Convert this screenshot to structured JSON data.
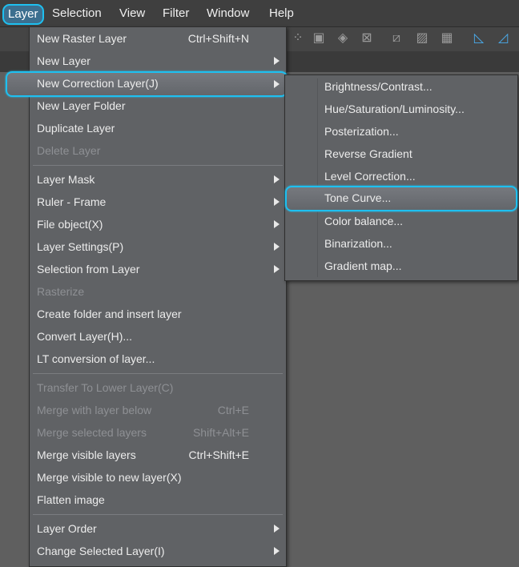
{
  "menubar": {
    "items": [
      "Layer",
      "Selection",
      "View",
      "Filter",
      "Window",
      "Help"
    ]
  },
  "toolbar": {
    "icons": [
      "transform-icon",
      "fill-icon",
      "selection-icon",
      "crop-icon",
      "rule-icon",
      "grid-icon",
      "film-icon",
      "blue-tool-icon-1",
      "blue-tool-icon-2"
    ]
  },
  "layer_menu": {
    "items": [
      {
        "label": "New Raster Layer",
        "shortcut": "Ctrl+Shift+N"
      },
      {
        "label": "New Layer",
        "submenu": true
      },
      {
        "label": "New Correction Layer(J)",
        "submenu": true,
        "highlighted": true
      },
      {
        "label": "New Layer Folder"
      },
      {
        "label": "Duplicate Layer"
      },
      {
        "label": "Delete Layer",
        "disabled": true
      },
      {
        "label": "Layer Mask",
        "submenu": true
      },
      {
        "label": "Ruler - Frame",
        "submenu": true
      },
      {
        "label": "File object(X)",
        "submenu": true
      },
      {
        "label": "Layer Settings(P)",
        "submenu": true
      },
      {
        "label": "Selection from Layer",
        "submenu": true
      },
      {
        "label": "Rasterize",
        "disabled": true
      },
      {
        "label": "Create folder and insert layer"
      },
      {
        "label": "Convert Layer(H)..."
      },
      {
        "label": "LT conversion of layer..."
      },
      {
        "label": "Transfer To Lower Layer(C)",
        "disabled": true
      },
      {
        "label": "Merge with layer below",
        "shortcut": "Ctrl+E",
        "disabled": true
      },
      {
        "label": "Merge selected layers",
        "shortcut": "Shift+Alt+E",
        "disabled": true
      },
      {
        "label": "Merge visible layers",
        "shortcut": "Ctrl+Shift+E"
      },
      {
        "label": "Merge visible to new layer(X)"
      },
      {
        "label": "Flatten image"
      },
      {
        "label": "Layer Order",
        "submenu": true
      },
      {
        "label": "Change Selected Layer(I)",
        "submenu": true
      }
    ]
  },
  "correction_submenu": {
    "items": [
      {
        "label": "Brightness/Contrast..."
      },
      {
        "label": "Hue/Saturation/Luminosity..."
      },
      {
        "label": "Posterization..."
      },
      {
        "label": "Reverse Gradient"
      },
      {
        "label": "Level Correction..."
      },
      {
        "label": "Tone Curve...",
        "highlighted": true
      },
      {
        "label": "Color balance..."
      },
      {
        "label": "Binarization..."
      },
      {
        "label": "Gradient map..."
      }
    ]
  },
  "colors": {
    "highlight_ring": "#1ec0f0",
    "menu_bg": "#606265",
    "disabled_text": "#8e9094"
  }
}
